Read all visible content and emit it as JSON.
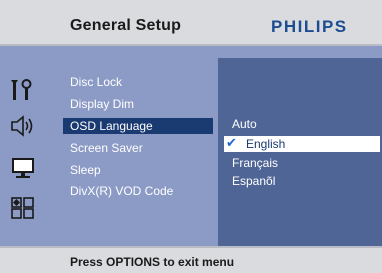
{
  "header": {
    "title": "General Setup",
    "brand": "PHILIPS"
  },
  "sidebar": {
    "icons": [
      "settings-icon",
      "audio-icon",
      "display-icon",
      "grid-icon"
    ]
  },
  "menu": {
    "items": [
      {
        "label": "Disc Lock"
      },
      {
        "label": "Display Dim"
      },
      {
        "label": "OSD Language"
      },
      {
        "label": "Screen Saver"
      },
      {
        "label": "Sleep"
      },
      {
        "label": "DivX(R) VOD Code"
      }
    ],
    "selected_index": 2
  },
  "options": {
    "items": [
      "Auto",
      "English",
      "Français",
      "Espanõl"
    ],
    "selected_index": 1
  },
  "footer": {
    "hint": "Press OPTIONS to exit menu"
  },
  "colors": {
    "brand": "#1d4d91",
    "panel": "#8c9bc6",
    "options_panel": "#4f6596",
    "menu_highlight": "#1a3a72",
    "check": "#1f63d9"
  }
}
